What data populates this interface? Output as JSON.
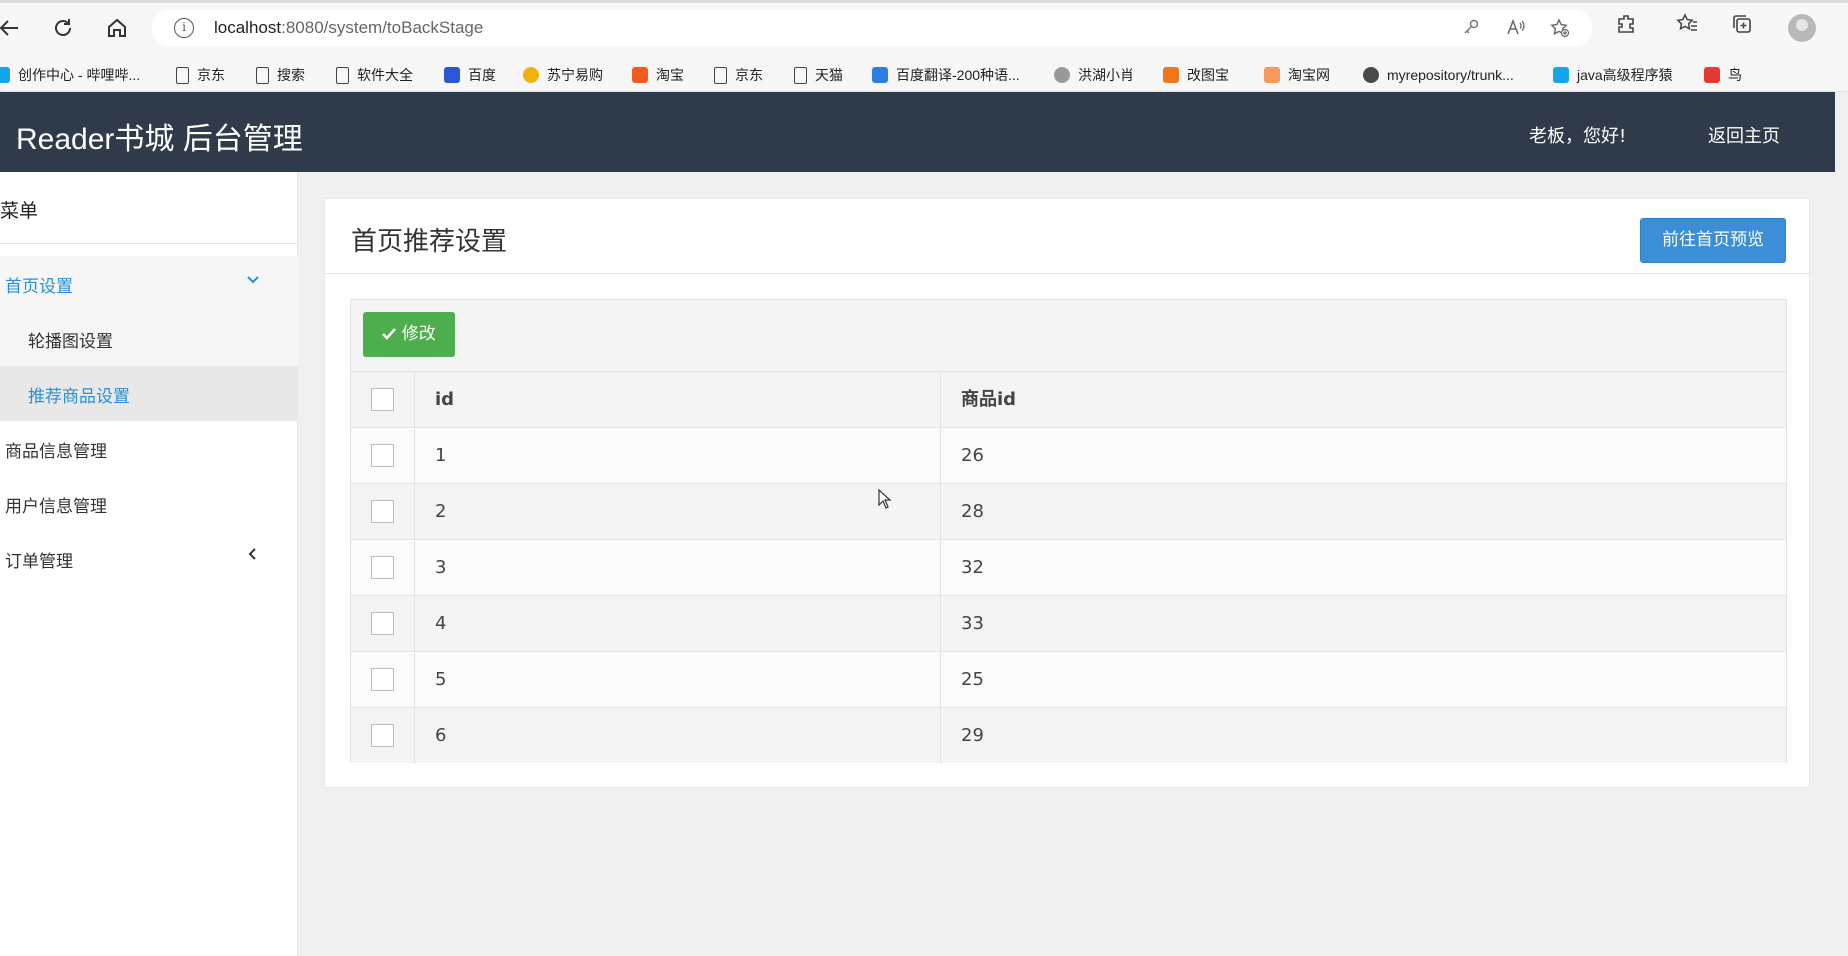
{
  "browser": {
    "url_host": "localhost",
    "url_rest": ":8080/system/toBackStage",
    "bookmarks": [
      {
        "label": "创作中心 - 哔哩哔...",
        "icon": "bilibili-icon"
      },
      {
        "label": "京东",
        "icon": "page-icon"
      },
      {
        "label": "搜索",
        "icon": "page-icon"
      },
      {
        "label": "软件大全",
        "icon": "page-icon"
      },
      {
        "label": "百度",
        "icon": "baidu-icon"
      },
      {
        "label": "苏宁易购",
        "icon": "suning-icon"
      },
      {
        "label": "淘宝",
        "icon": "taobao-icon"
      },
      {
        "label": "京东",
        "icon": "page-icon"
      },
      {
        "label": "天猫",
        "icon": "page-icon"
      },
      {
        "label": "百度翻译-200种语...",
        "icon": "translate-icon"
      },
      {
        "label": "洪湖小肖",
        "icon": "bird-icon"
      },
      {
        "label": "改图宝",
        "icon": "gaitubao-icon"
      },
      {
        "label": "淘宝网",
        "icon": "taobao-icon"
      },
      {
        "label": "myrepository/trunk...",
        "icon": "chrome-icon"
      },
      {
        "label": "java高级程序猿",
        "icon": "bilibili-icon"
      },
      {
        "label": "鸟",
        "icon": "bird-red-icon"
      }
    ]
  },
  "header": {
    "title": "Reader书城 后台管理",
    "greeting": "老板，您好!",
    "home_link": "返回主页"
  },
  "sidebar": {
    "menu_title": "菜单",
    "items": [
      {
        "label": "首页设置"
      },
      {
        "label": "轮播图设置"
      },
      {
        "label": "推荐商品设置"
      },
      {
        "label": "商品信息管理"
      },
      {
        "label": "用户信息管理"
      },
      {
        "label": "订单管理"
      }
    ]
  },
  "main": {
    "title": "首页推荐设置",
    "preview_button": "前往首页预览",
    "edit_button": "修改",
    "table": {
      "headers": [
        "id",
        "商品id"
      ],
      "rows": [
        {
          "id": "1",
          "goods_id": "26"
        },
        {
          "id": "2",
          "goods_id": "28"
        },
        {
          "id": "3",
          "goods_id": "32"
        },
        {
          "id": "4",
          "goods_id": "33"
        },
        {
          "id": "5",
          "goods_id": "25"
        },
        {
          "id": "6",
          "goods_id": "29"
        }
      ]
    }
  },
  "colors": {
    "header_bg": "#2f3a4a",
    "accent_blue": "#2a8fd8",
    "preview_button": "#3c8fd6",
    "edit_button": "#4cae4c"
  }
}
